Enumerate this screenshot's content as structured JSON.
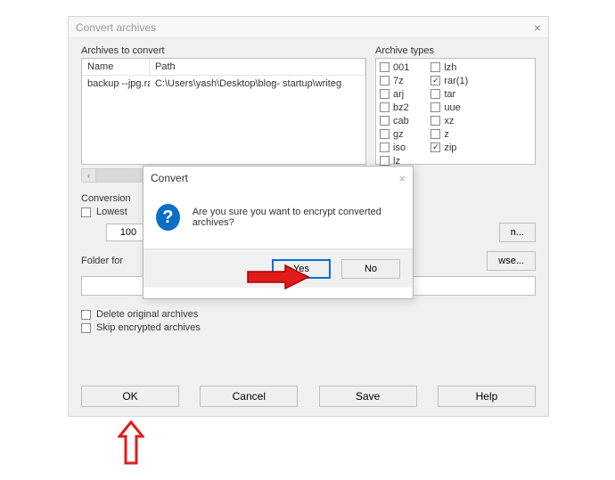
{
  "window": {
    "title": "Convert archives",
    "archives_label": "Archives to convert",
    "types_label": "Archive types",
    "columns": {
      "name": "Name",
      "path": "Path"
    },
    "rows": [
      {
        "name": "backup --jpg.rar",
        "path": "C:\\Users\\yash\\Desktop\\blog- startup\\writeg"
      }
    ],
    "types_col1": [
      {
        "label": "001",
        "checked": false
      },
      {
        "label": "7z",
        "checked": false
      },
      {
        "label": "arj",
        "checked": false
      },
      {
        "label": "bz2",
        "checked": false
      },
      {
        "label": "cab",
        "checked": false
      },
      {
        "label": "gz",
        "checked": false
      },
      {
        "label": "iso",
        "checked": false
      },
      {
        "label": "lz",
        "checked": false
      }
    ],
    "types_col2": [
      {
        "label": "lzh",
        "checked": false
      },
      {
        "label": "rar(1)",
        "checked": true
      },
      {
        "label": "tar",
        "checked": false
      },
      {
        "label": "uue",
        "checked": false
      },
      {
        "label": "xz",
        "checked": false
      },
      {
        "label": "z",
        "checked": false
      },
      {
        "label": "zip",
        "checked": true
      }
    ],
    "conversion_label": "Conversion",
    "lowest_label": "Lowest",
    "lowest_value": "100",
    "compression_btn": "n...",
    "folder_label": "Folder for",
    "browse_btn": "wse...",
    "folder_value": "",
    "delete_original": "Delete original archives",
    "skip_encrypted": "Skip encrypted archives",
    "buttons": {
      "ok": "OK",
      "cancel": "Cancel",
      "save": "Save",
      "help": "Help"
    }
  },
  "modal": {
    "title": "Convert",
    "message": "Are you sure you want to encrypt converted archives?",
    "yes": "Yes",
    "no": "No"
  }
}
